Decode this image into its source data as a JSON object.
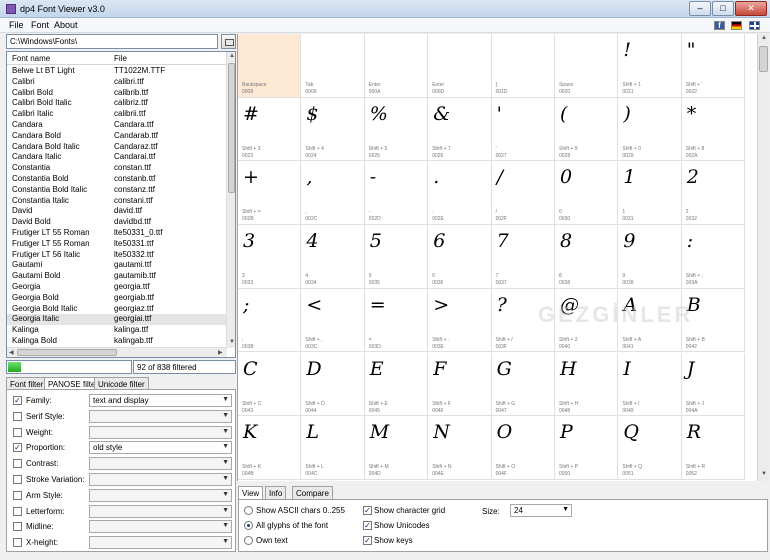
{
  "window": {
    "title": "dp4 Font Viewer v3.0"
  },
  "menu": {
    "items": [
      "File",
      "Font",
      "About"
    ]
  },
  "path": {
    "value": "C:\\Windows\\Fonts\\"
  },
  "font_list": {
    "headers": {
      "name": "Font name",
      "file": "File"
    },
    "rows": [
      {
        "name": "Belwe Lt BT Light",
        "file": "TT1022M.TTF"
      },
      {
        "name": "Calibri",
        "file": "calibri.ttf"
      },
      {
        "name": "Calibri Bold",
        "file": "calibrib.ttf"
      },
      {
        "name": "Calibri Bold Italic",
        "file": "calibriz.ttf"
      },
      {
        "name": "Calibri Italic",
        "file": "calibrii.ttf"
      },
      {
        "name": "Candara",
        "file": "Candara.ttf"
      },
      {
        "name": "Candara Bold",
        "file": "Candarab.ttf"
      },
      {
        "name": "Candara Bold Italic",
        "file": "Candaraz.ttf"
      },
      {
        "name": "Candara Italic",
        "file": "Candarai.ttf"
      },
      {
        "name": "Constantia",
        "file": "constan.ttf"
      },
      {
        "name": "Constantia Bold",
        "file": "constanb.ttf"
      },
      {
        "name": "Constantia Bold Italic",
        "file": "constanz.ttf"
      },
      {
        "name": "Constantia Italic",
        "file": "constani.ttf"
      },
      {
        "name": "David",
        "file": "david.ttf"
      },
      {
        "name": "David Bold",
        "file": "davidbd.ttf"
      },
      {
        "name": "Frutiger LT 55 Roman",
        "file": "lte50331_0.ttf"
      },
      {
        "name": "Frutiger LT 55 Roman",
        "file": "lte50331.ttf"
      },
      {
        "name": "Frutiger LT 56 Italic",
        "file": "lte50332.ttf"
      },
      {
        "name": "Gautami",
        "file": "gautami.ttf"
      },
      {
        "name": "Gautami Bold",
        "file": "gautamib.ttf"
      },
      {
        "name": "Georgia",
        "file": "georgia.ttf"
      },
      {
        "name": "Georgia Bold",
        "file": "georgiab.ttf"
      },
      {
        "name": "Georgia Bold Italic",
        "file": "georgiaz.ttf"
      },
      {
        "name": "Georgia Italic",
        "file": "georgiai.ttf"
      },
      {
        "name": "Kalinga",
        "file": "kalinga.ttf"
      },
      {
        "name": "Kalinga Bold",
        "file": "kalingab.ttf"
      }
    ],
    "selected_index": 23
  },
  "filter_status": {
    "progress": 0.11,
    "text": "92 of 838 filtered"
  },
  "filter_tabs": [
    "Font filter",
    "PANOSE filter",
    "Unicode filter"
  ],
  "panose": [
    {
      "label": "Family:",
      "checked": true,
      "value": "text and display"
    },
    {
      "label": "Serif Style:",
      "checked": false,
      "value": ""
    },
    {
      "label": "Weight:",
      "checked": false,
      "value": ""
    },
    {
      "label": "Proportion:",
      "checked": true,
      "value": "old style"
    },
    {
      "label": "Contrast:",
      "checked": false,
      "value": ""
    },
    {
      "label": "Stroke Variation:",
      "checked": false,
      "value": ""
    },
    {
      "label": "Arm Style:",
      "checked": false,
      "value": ""
    },
    {
      "label": "Letterform:",
      "checked": false,
      "value": ""
    },
    {
      "label": "Midline:",
      "checked": false,
      "value": ""
    },
    {
      "label": "X-height:",
      "checked": false,
      "value": ""
    }
  ],
  "glyphs": [
    {
      "g": "",
      "key": "Backspace",
      "code": "0008"
    },
    {
      "g": "",
      "key": "Tab",
      "code": "0009"
    },
    {
      "g": "",
      "key": "Enter",
      "code": "000A"
    },
    {
      "g": "",
      "key": "Enter",
      "code": "000D"
    },
    {
      "g": "",
      "key": "]",
      "code": "001D"
    },
    {
      "g": "",
      "key": "Space",
      "code": "0020"
    },
    {
      "g": "!",
      "key": "Shift + 1",
      "code": "0021"
    },
    {
      "g": "\"",
      "key": "Shift + '",
      "code": "0022"
    },
    {
      "g": "#",
      "key": "Shift + 3",
      "code": "0023"
    },
    {
      "g": "$",
      "key": "Shift + 4",
      "code": "0024"
    },
    {
      "g": "%",
      "key": "Shift + 5",
      "code": "0025"
    },
    {
      "g": "&",
      "key": "Shift + 7",
      "code": "0026"
    },
    {
      "g": "'",
      "key": "'",
      "code": "0027"
    },
    {
      "g": "(",
      "key": "Shift + 9",
      "code": "0028"
    },
    {
      "g": ")",
      "key": "Shift + 0",
      "code": "0029"
    },
    {
      "g": "*",
      "key": "Shift + 8",
      "code": "002A"
    },
    {
      "g": "+",
      "key": "Shift + =",
      "code": "002B"
    },
    {
      "g": ",",
      "key": ",",
      "code": "002C"
    },
    {
      "g": "-",
      "key": "-",
      "code": "002D"
    },
    {
      "g": ".",
      "key": ".",
      "code": "002E"
    },
    {
      "g": "/",
      "key": "/",
      "code": "002F"
    },
    {
      "g": "0",
      "key": "0",
      "code": "0030"
    },
    {
      "g": "1",
      "key": "1",
      "code": "0031"
    },
    {
      "g": "2",
      "key": "2",
      "code": "0032"
    },
    {
      "g": "3",
      "key": "3",
      "code": "0033"
    },
    {
      "g": "4",
      "key": "4",
      "code": "0034"
    },
    {
      "g": "5",
      "key": "5",
      "code": "0035"
    },
    {
      "g": "6",
      "key": "6",
      "code": "0036"
    },
    {
      "g": "7",
      "key": "7",
      "code": "0037"
    },
    {
      "g": "8",
      "key": "8",
      "code": "0038"
    },
    {
      "g": "9",
      "key": "9",
      "code": "0039"
    },
    {
      "g": ":",
      "key": "Shift + ;",
      "code": "003A"
    },
    {
      "g": ";",
      "key": ";",
      "code": "003B"
    },
    {
      "g": "<",
      "key": "Shift + ,",
      "code": "003C"
    },
    {
      "g": "=",
      "key": "=",
      "code": "003D"
    },
    {
      "g": ">",
      "key": "Shift + .",
      "code": "003E"
    },
    {
      "g": "?",
      "key": "Shift + /",
      "code": "003F"
    },
    {
      "g": "@",
      "key": "Shift + 2",
      "code": "0040"
    },
    {
      "g": "A",
      "key": "Shift + A",
      "code": "0041"
    },
    {
      "g": "B",
      "key": "Shift + B",
      "code": "0042"
    },
    {
      "g": "C",
      "key": "Shift + C",
      "code": "0043"
    },
    {
      "g": "D",
      "key": "Shift + D",
      "code": "0044"
    },
    {
      "g": "E",
      "key": "Shift + E",
      "code": "0045"
    },
    {
      "g": "F",
      "key": "Shift + F",
      "code": "0046"
    },
    {
      "g": "G",
      "key": "Shift + G",
      "code": "0047"
    },
    {
      "g": "H",
      "key": "Shift + H",
      "code": "0048"
    },
    {
      "g": "I",
      "key": "Shift + I",
      "code": "0049"
    },
    {
      "g": "J",
      "key": "Shift + J",
      "code": "004A"
    },
    {
      "g": "K",
      "key": "Shift + K",
      "code": "004B"
    },
    {
      "g": "L",
      "key": "Shift + L",
      "code": "004C"
    },
    {
      "g": "M",
      "key": "Shift + M",
      "code": "004D"
    },
    {
      "g": "N",
      "key": "Shift + N",
      "code": "004E"
    },
    {
      "g": "O",
      "key": "Shift + O",
      "code": "004F"
    },
    {
      "g": "P",
      "key": "Shift + P",
      "code": "0050"
    },
    {
      "g": "Q",
      "key": "Shift + Q",
      "code": "0051"
    },
    {
      "g": "R",
      "key": "Shift + R",
      "code": "0052"
    }
  ],
  "view_tabs": [
    "View",
    "Info",
    "Compare"
  ],
  "view_options": {
    "show_ascii": "Show ASCII chars 0..255",
    "all_glyphs": "All glyphs of the font",
    "own_text": "Own text",
    "show_grid": "Show character grid",
    "show_unicodes": "Show Unicodes",
    "show_keys": "Show keys",
    "size_label": "Size:",
    "size_value": "24"
  },
  "watermark": "GEZGİNLER",
  "colors": {
    "highlight": "#fde8d4",
    "progress": "#1fa91f",
    "accent": "#1d3f8f"
  }
}
